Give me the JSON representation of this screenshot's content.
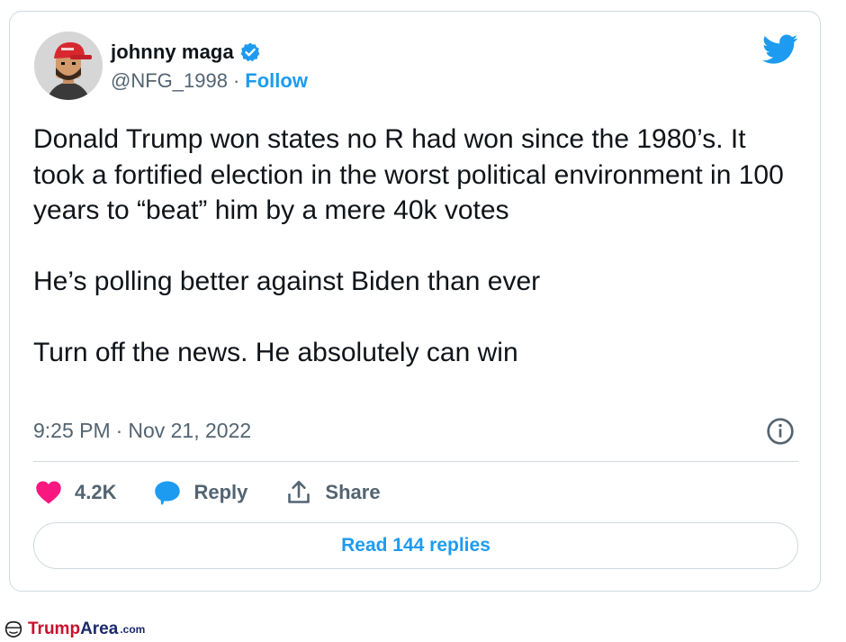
{
  "user": {
    "display_name": "johnny maga",
    "handle": "@NFG_1998",
    "separator": "·",
    "follow_label": "Follow"
  },
  "tweet": {
    "text": "Donald Trump won states no R had won since the 1980’s. It took a fortified election in the worst political environment in 100 years to “beat” him by a mere 40k votes\n\nHe’s polling better against Biden than ever\n\nTurn off the news. He absolutely can win",
    "time": "9:25 PM",
    "separator": "·",
    "date": "Nov 21, 2022"
  },
  "actions": {
    "likes_count": "4.2K",
    "reply_label": "Reply",
    "share_label": "Share"
  },
  "read_replies_label": "Read 144 replies",
  "watermark": {
    "part1": "Trump",
    "part2": "Area",
    "part3": ".com"
  },
  "colors": {
    "accent": "#1d9bf0",
    "like": "#f91880",
    "text": "#0f1419",
    "secondary": "#536471",
    "border": "#cfd9de"
  },
  "icons": [
    "verified-badge-icon",
    "twitter-bird-icon",
    "info-icon",
    "heart-icon",
    "reply-bubble-icon",
    "share-icon",
    "trumparea-logo-icon"
  ]
}
